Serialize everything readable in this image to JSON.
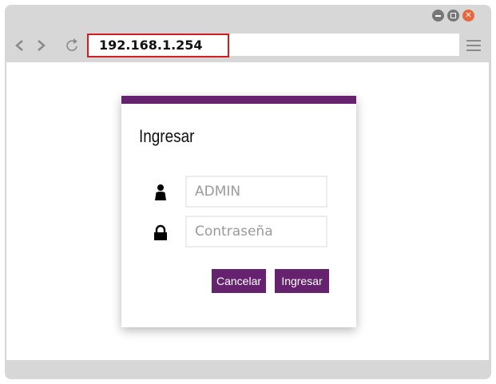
{
  "browser": {
    "url": "192.168.1.254",
    "nav": {
      "back": "<",
      "forward": ">",
      "reload": "↻"
    },
    "colors": {
      "chrome": "#d7d7d7",
      "close": "#e9673d",
      "highlight": "#d01e1e"
    }
  },
  "login": {
    "title": "Ingresar",
    "username_value": "ADMIN",
    "password_placeholder": "Contraseña",
    "cancel_label": "Cancelar",
    "submit_label": "Ingresar",
    "accent_color": "#66226f",
    "icons": {
      "user": "user-icon",
      "password": "lock-icon"
    }
  }
}
